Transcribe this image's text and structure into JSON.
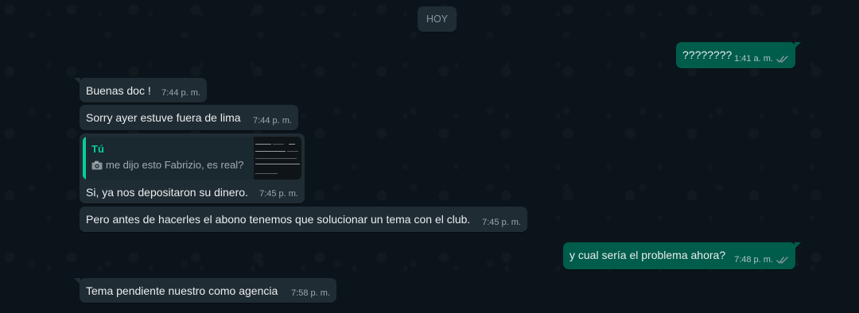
{
  "chat": {
    "date_separator": "HOY",
    "messages": [
      {
        "direction": "out",
        "text": "????????",
        "time": "1:41 a. m.",
        "status": "read-double-check"
      },
      {
        "direction": "in",
        "text": "Buenas doc !",
        "time": "7:44 p. m."
      },
      {
        "direction": "in",
        "text": "Sorry ayer estuve fuera de lima",
        "time": "7:44 p. m."
      },
      {
        "direction": "in",
        "quoted": {
          "author": "Tú",
          "preview": "me dijo esto Fabrizio, es real?",
          "type": "photo"
        },
        "text": "Si, ya nos depositaron su dinero.",
        "time": "7:45 p. m."
      },
      {
        "direction": "in",
        "text": "Pero antes de hacerles el abono tenemos que solucionar un tema con el club.",
        "time": "7:45 p. m."
      },
      {
        "direction": "out",
        "text": "y cual sería el problema ahora?",
        "time": "7:48 p. m.",
        "status": "read-double-check"
      },
      {
        "direction": "in",
        "text": "Tema pendiente nuestro como agencia",
        "time": "7:58 p. m."
      }
    ]
  },
  "colors": {
    "background": "#0b141a",
    "incoming_bubble": "#202c33",
    "outgoing_bubble": "#005c4b",
    "accent": "#06cf9c",
    "read_ticks": "#8696a0"
  },
  "icons": {
    "quote_media": "camera-icon",
    "message_status": "double-check-icon"
  }
}
